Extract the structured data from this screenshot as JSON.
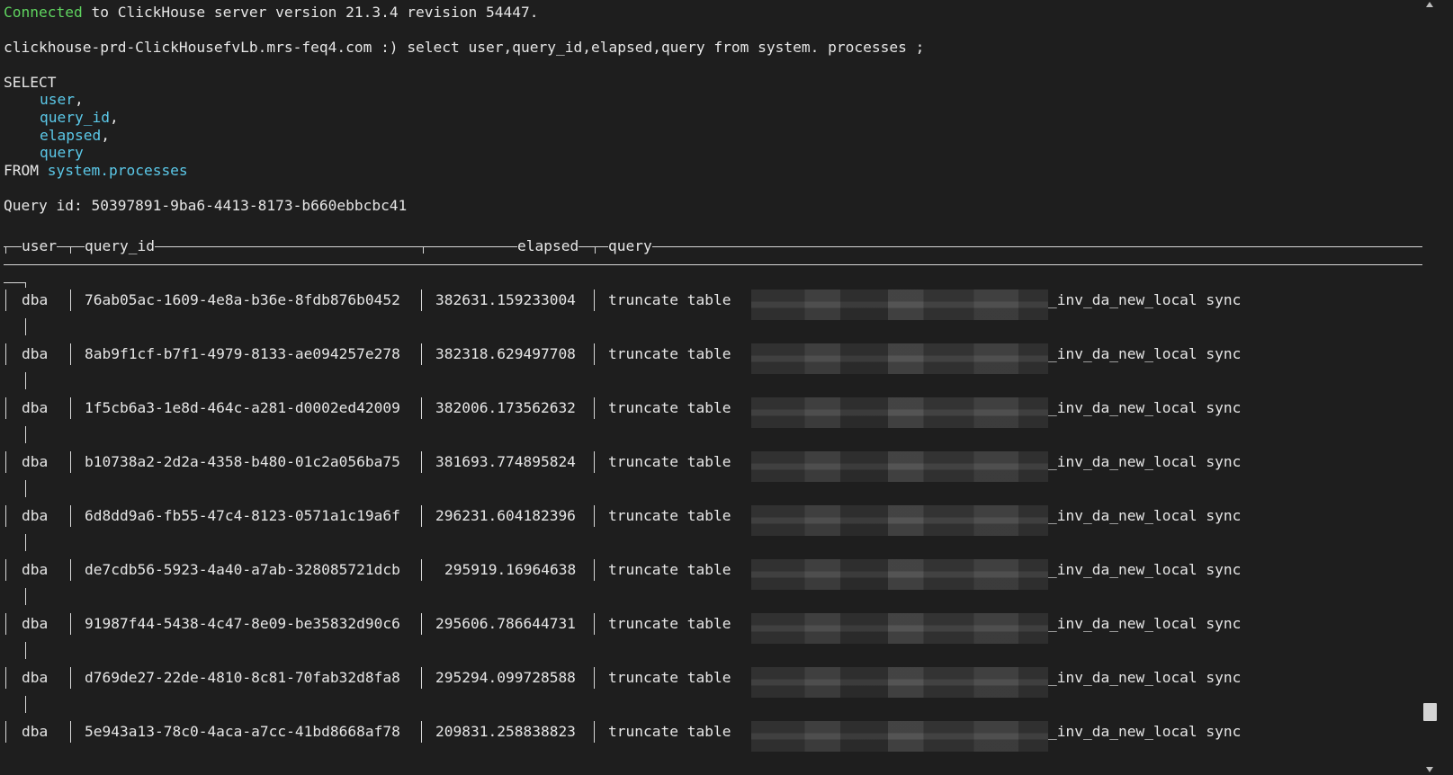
{
  "connection": {
    "status_word": "Connected",
    "message": " to ClickHouse server version 21.3.4 revision 54447."
  },
  "prompt": {
    "host": "clickhouse-prd-ClickHousefvLb.mrs-feq4.com :) ",
    "command": "select user,query_id,elapsed,query from system. processes ;"
  },
  "formatted_query": {
    "select": "SELECT",
    "fields": [
      "user",
      "query_id",
      "elapsed",
      "query"
    ],
    "from": "FROM",
    "table": "system",
    "table_suffix": ".processes"
  },
  "query_id": "Query id: 50397891-9ba6-4413-8173-b660ebbcbc41",
  "table": {
    "headers": [
      "user",
      "query_id",
      "elapsed",
      "query"
    ],
    "rows": [
      {
        "user": "dba",
        "query_id": "76ab05ac-1609-4e8a-b36e-8fdb876b0452",
        "elapsed": "382631.159233004",
        "query_start": "truncate table",
        "query_end": "_inv_da_new_local sync"
      },
      {
        "user": "dba",
        "query_id": "8ab9f1cf-b7f1-4979-8133-ae094257e278",
        "elapsed": "382318.629497708",
        "query_start": "truncate table",
        "query_end": "_inv_da_new_local sync"
      },
      {
        "user": "dba",
        "query_id": "1f5cb6a3-1e8d-464c-a281-d0002ed42009",
        "elapsed": "382006.173562632",
        "query_start": "truncate table",
        "query_end": "_inv_da_new_local sync"
      },
      {
        "user": "dba",
        "query_id": "b10738a2-2d2a-4358-b480-01c2a056ba75",
        "elapsed": "381693.774895824",
        "query_start": "truncate table",
        "query_end": "_inv_da_new_local sync"
      },
      {
        "user": "dba",
        "query_id": "6d8dd9a6-fb55-47c4-8123-0571a1c19a6f",
        "elapsed": "296231.604182396",
        "query_start": "truncate table",
        "query_end": "_inv_da_new_local sync"
      },
      {
        "user": "dba",
        "query_id": "de7cdb56-5923-4a40-a7ab-328085721dcb",
        "elapsed": "295919.16964638",
        "query_start": "truncate table",
        "query_end": "_inv_da_new_local sync"
      },
      {
        "user": "dba",
        "query_id": "91987f44-5438-4c47-8e09-be35832d90c6",
        "elapsed": "295606.786644731",
        "query_start": "truncate table",
        "query_end": "_inv_da_new_local sync"
      },
      {
        "user": "dba",
        "query_id": "d769de27-22de-4810-8c81-70fab32d8fa8",
        "elapsed": "295294.099728588",
        "query_start": "truncate table",
        "query_end": "_inv_da_new_local sync"
      },
      {
        "user": "dba",
        "query_id": "5e943a13-78c0-4aca-a7cc-41bd8668af78",
        "elapsed": "209831.258838823",
        "query_start": "truncate table",
        "query_end": "_inv_da_new_local sync"
      }
    ]
  },
  "icons": {
    "scroll_up": "triangle-up-icon",
    "scroll_down": "triangle-down-icon"
  },
  "colors": {
    "background": "#1e1e1e",
    "text": "#e6e6e6",
    "connected": "#5fd35f",
    "identifier": "#5bc8e8",
    "redaction": "#444444"
  }
}
